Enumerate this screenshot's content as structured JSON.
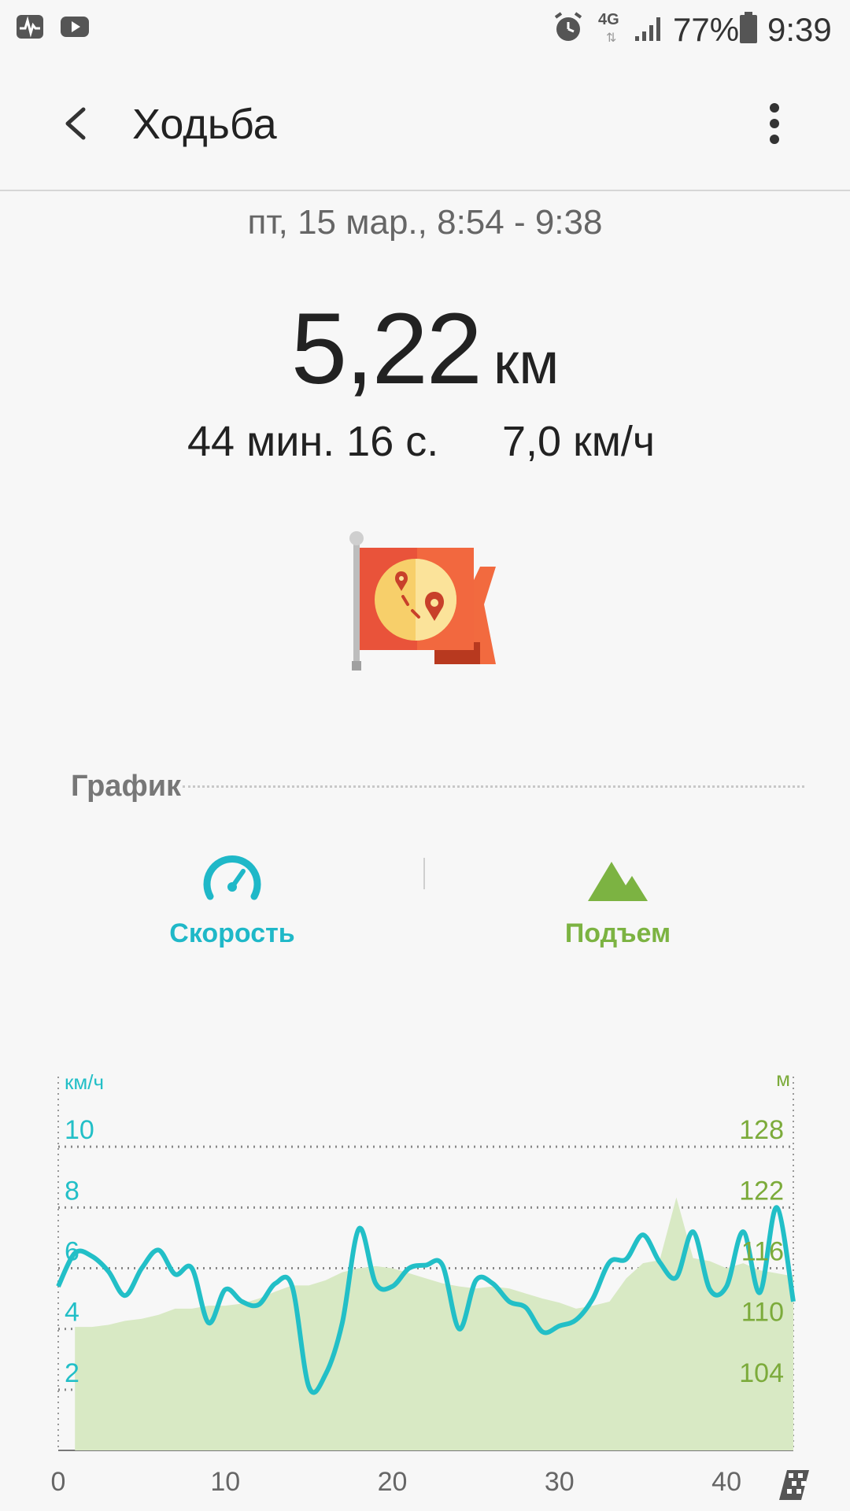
{
  "status_bar": {
    "network": "4G",
    "battery": "77%",
    "time": "9:39",
    "icons": [
      "activity-icon",
      "youtube-icon",
      "alarm-icon",
      "signal-icon",
      "battery-icon"
    ]
  },
  "app_bar": {
    "title": "Ходьба",
    "back_icon": "back-arrow-icon",
    "menu_icon": "more-vertical-icon"
  },
  "summary": {
    "datetime": "пт, 15 мар., 8:54 - 9:38",
    "distance_value": "5,22",
    "distance_unit": "км",
    "duration": "44 мин. 16 с.",
    "avg_speed": "7,0 км/ч",
    "badge_icon": "route-flag-icon"
  },
  "chart_section": {
    "label": "График",
    "tabs": [
      {
        "label": "Скорость",
        "icon": "speedometer-icon",
        "color": "#1fb8c8"
      },
      {
        "label": "Подъем",
        "icon": "mountain-icon",
        "color": "#7cb342"
      }
    ]
  },
  "colors": {
    "speed": "#22bfc7",
    "altitude_fill": "#d8e9c4",
    "altitude_text": "#7cab3b",
    "flag": "#e9533a"
  },
  "chart_data": {
    "type": "line",
    "x_ticks": [
      "0",
      "10",
      "20",
      "30",
      "40"
    ],
    "xlim": [
      0,
      44
    ],
    "left_axis": {
      "unit": "км/ч",
      "ticks": [
        "2",
        "4",
        "6",
        "8",
        "10"
      ],
      "ylim": [
        0,
        12
      ]
    },
    "right_axis": {
      "unit": "м",
      "ticks": [
        "104",
        "110",
        "116",
        "122",
        "128"
      ],
      "ylim": [
        98,
        134
      ]
    },
    "series": [
      {
        "type": "line",
        "x": [
          0,
          1,
          2,
          3,
          4,
          5,
          6,
          7,
          8,
          9,
          10,
          11,
          12,
          13,
          14,
          15,
          16,
          17,
          18,
          19,
          20,
          21,
          22,
          23,
          24,
          25,
          26,
          27,
          28,
          29,
          30,
          31,
          32,
          33,
          34,
          35,
          36,
          37,
          38,
          39,
          40,
          41,
          42,
          43,
          44
        ],
        "y": [
          5.4,
          6.5,
          6.4,
          5.9,
          5.1,
          6.0,
          6.6,
          5.8,
          6.0,
          4.2,
          5.3,
          4.9,
          4.8,
          5.5,
          5.4,
          2.1,
          2.5,
          4.2,
          7.3,
          5.5,
          5.4,
          6.0,
          6.1,
          6.1,
          4.0,
          5.6,
          5.5,
          4.9,
          4.7,
          3.9,
          4.1,
          4.3,
          5.0,
          6.2,
          6.3,
          7.1,
          6.2,
          5.7,
          7.2,
          5.3,
          5.4,
          7.2,
          5.2,
          8.0,
          4.9
        ]
      },
      {
        "type": "area",
        "x": [
          1,
          2,
          3,
          4,
          5,
          6,
          7,
          8,
          9,
          10,
          11,
          12,
          13,
          14,
          15,
          16,
          17,
          18,
          19,
          20,
          21,
          22,
          23,
          24,
          25,
          26,
          27,
          28,
          29,
          30,
          31,
          32,
          33,
          34,
          35,
          36,
          37,
          38,
          39,
          40,
          41,
          42,
          43,
          44
        ],
        "y": [
          110.2,
          110.2,
          110.4,
          110.8,
          111.0,
          111.4,
          112.0,
          112.0,
          112.3,
          112.3,
          112.5,
          113.0,
          113.7,
          114.3,
          114.3,
          114.8,
          115.6,
          116.0,
          116.2,
          116.0,
          115.5,
          115.0,
          114.5,
          114.2,
          114.0,
          114.2,
          114.0,
          113.5,
          113.0,
          112.6,
          112.0,
          112.3,
          112.7,
          115.0,
          116.5,
          116.8,
          123.0,
          117.0,
          116.7,
          116.0,
          116.5,
          115.8,
          115.5,
          115.2
        ]
      }
    ]
  }
}
